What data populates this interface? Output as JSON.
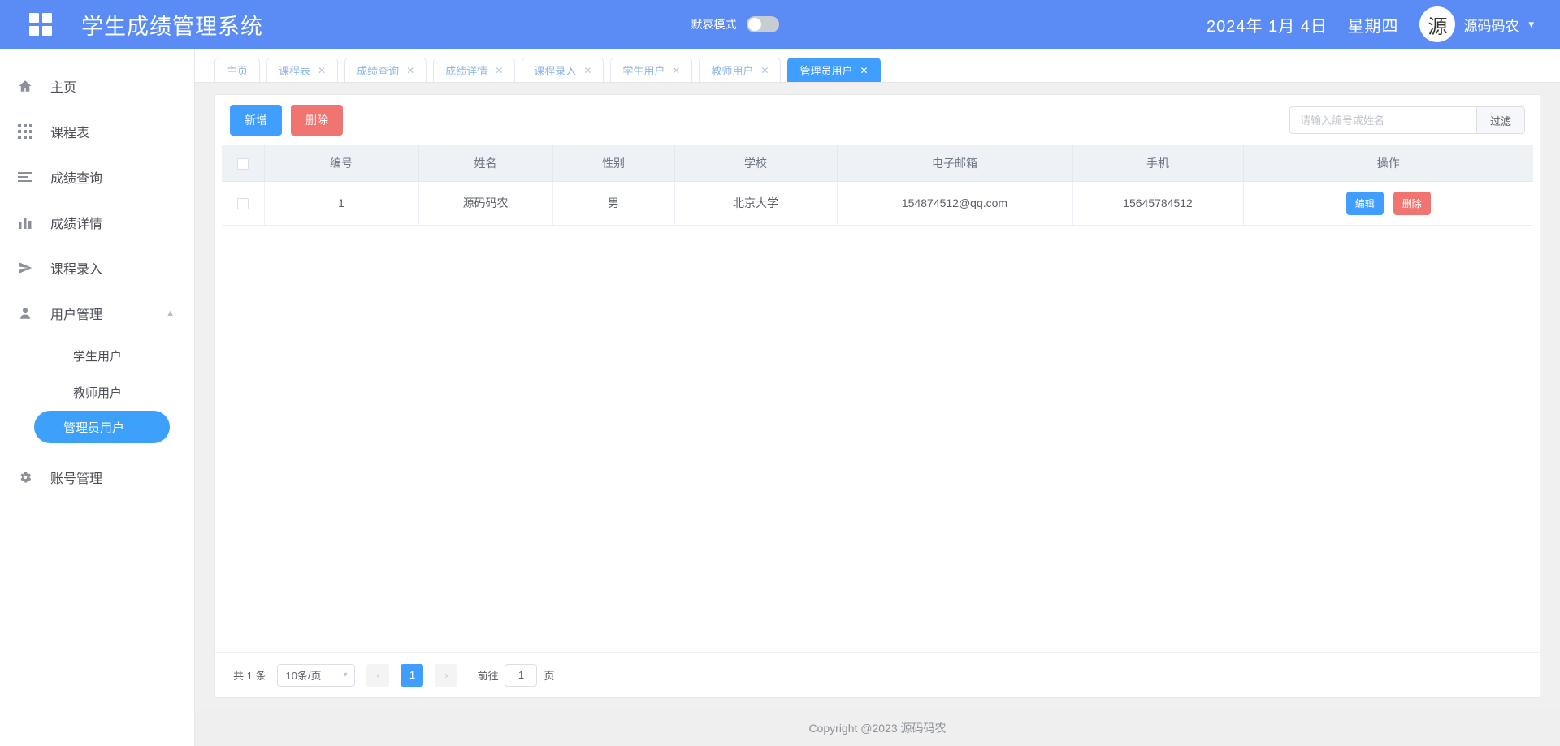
{
  "header": {
    "logo_icon": "grid-apps-icon",
    "title": "学生成绩管理系统",
    "mode_label": "默哀模式",
    "mode_on": false,
    "date": "2024年 1月 4日",
    "weekday": "星期四",
    "avatar_text": "源",
    "user_name": "源码码农",
    "caret_icon": "chevron-down-icon",
    "bg_color": "#5b8cf5"
  },
  "sidebar": {
    "items": [
      {
        "label": "主页",
        "icon": "home-icon"
      },
      {
        "label": "课程表",
        "icon": "grid-icon"
      },
      {
        "label": "成绩查询",
        "icon": "list-icon"
      },
      {
        "label": "成绩详情",
        "icon": "bar-chart-icon"
      },
      {
        "label": "课程录入",
        "icon": "paper-plane-icon"
      },
      {
        "label": "用户管理",
        "icon": "user-icon",
        "arrow_icon": "chevron-up-icon",
        "expanded": true
      },
      {
        "label": "账号管理",
        "icon": "gear-icon"
      }
    ],
    "submenu": [
      {
        "label": "学生用户",
        "active": false
      },
      {
        "label": "教师用户",
        "active": false
      },
      {
        "label": "管理员用户",
        "active": true
      }
    ],
    "active_color": "#3da0fb"
  },
  "tabs": [
    {
      "label": "主页",
      "closable": false,
      "active": false
    },
    {
      "label": "课程表",
      "closable": true,
      "active": false
    },
    {
      "label": "成绩查询",
      "closable": true,
      "active": false
    },
    {
      "label": "成绩详情",
      "closable": true,
      "active": false
    },
    {
      "label": "课程录入",
      "closable": true,
      "active": false
    },
    {
      "label": "学生用户",
      "closable": true,
      "active": false
    },
    {
      "label": "教师用户",
      "closable": true,
      "active": false
    },
    {
      "label": "管理员用户",
      "closable": true,
      "active": true
    }
  ],
  "tab_close_icon": "close-icon",
  "toolbar": {
    "add_label": "新增",
    "delete_label": "删除",
    "add_color": "#409eff",
    "delete_color": "#f07470"
  },
  "search": {
    "placeholder": "请输入编号或姓名",
    "value": "",
    "filter_label": "过滤"
  },
  "table": {
    "columns": [
      "",
      "编号",
      "姓名",
      "性别",
      "学校",
      "电子邮箱",
      "手机",
      "操作"
    ],
    "rows": [
      {
        "id": "1",
        "name": "源码码农",
        "gender": "男",
        "school": "北京大学",
        "email": "154874512@qq.com",
        "phone": "15645784512",
        "edit_label": "编辑",
        "delete_label": "删除"
      }
    ]
  },
  "pager": {
    "total_label": "共 1 条",
    "page_size_label": "10条/页",
    "prev_icon": "chevron-left-icon",
    "next_icon": "chevron-right-icon",
    "current_page": "1",
    "jump_prefix": "前往",
    "jump_value": "1",
    "jump_suffix": "页"
  },
  "footer": {
    "copyright": "Copyright @2023 源码码农"
  }
}
